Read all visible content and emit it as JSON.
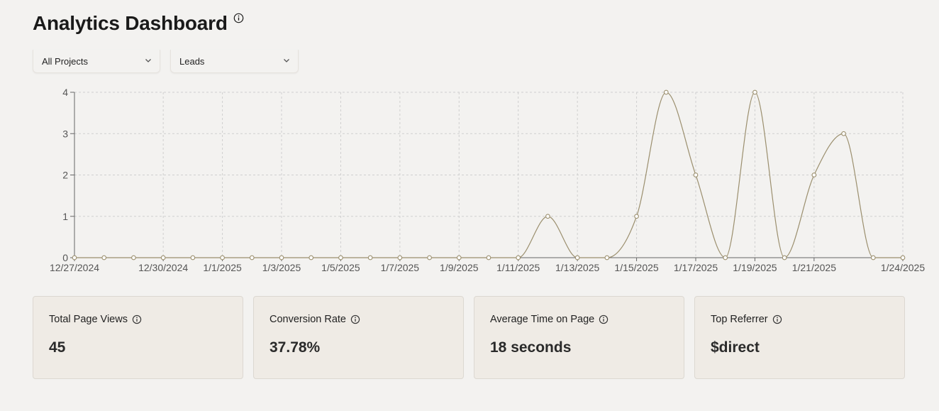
{
  "header": {
    "title": "Analytics Dashboard",
    "info_icon": "info-circle-icon"
  },
  "filters": {
    "project": {
      "value": "All Projects",
      "icon": "chevron-down-icon"
    },
    "metric": {
      "value": "Leads",
      "icon": "chevron-down-icon"
    }
  },
  "chart_data": {
    "type": "line",
    "title": "",
    "xlabel": "",
    "ylabel": "",
    "x": [
      "12/27/2024",
      "12/28/2024",
      "12/29/2024",
      "12/30/2024",
      "12/31/2024",
      "1/1/2025",
      "1/2/2025",
      "1/3/2025",
      "1/4/2025",
      "1/5/2025",
      "1/6/2025",
      "1/7/2025",
      "1/8/2025",
      "1/9/2025",
      "1/10/2025",
      "1/11/2025",
      "1/12/2025",
      "1/13/2025",
      "1/14/2025",
      "1/15/2025",
      "1/16/2025",
      "1/17/2025",
      "1/18/2025",
      "1/19/2025",
      "1/20/2025",
      "1/21/2025",
      "1/22/2025",
      "1/23/2025",
      "1/24/2025"
    ],
    "values": [
      0,
      0,
      0,
      0,
      0,
      0,
      0,
      0,
      0,
      0,
      0,
      0,
      0,
      0,
      0,
      0,
      1,
      0,
      0,
      1,
      4,
      2,
      0,
      4,
      0,
      2,
      3,
      0,
      0
    ],
    "xticks": [
      "12/27/2024",
      "12/30/2024",
      "1/1/2025",
      "1/3/2025",
      "1/5/2025",
      "1/7/2025",
      "1/9/2025",
      "1/11/2025",
      "1/13/2025",
      "1/15/2025",
      "1/17/2025",
      "1/19/2025",
      "1/21/2025",
      "1/24/2025"
    ],
    "yticks": [
      0,
      1,
      2,
      3,
      4
    ],
    "ylim": [
      0,
      4
    ],
    "grid": true,
    "line_color": "#9b8f6e",
    "grid_color": "#cfcfcf"
  },
  "cards": [
    {
      "label": "Total Page Views",
      "value": "45"
    },
    {
      "label": "Conversion Rate",
      "value": "37.78%"
    },
    {
      "label": "Average Time on Page",
      "value": "18 seconds"
    },
    {
      "label": "Top Referrer",
      "value": "$direct"
    }
  ],
  "colors": {
    "background": "#f3f2f0",
    "card_background": "#efebe5",
    "card_border": "#dcd8d1"
  }
}
